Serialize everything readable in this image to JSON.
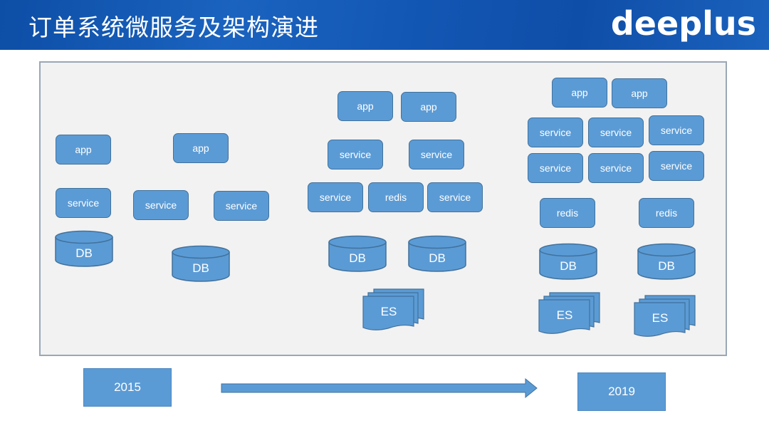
{
  "header": {
    "title": "订单系统微服务及架构演进",
    "logo": "deeplus",
    "background_color": "#1559b5"
  },
  "colors": {
    "node_fill": "#5b9bd5",
    "node_border": "#41719c",
    "panel_fill": "#f2f2f2",
    "panel_border": "#9aa7b6"
  },
  "stages": [
    {
      "name": "stage-2015",
      "apps": [
        "app",
        "app"
      ],
      "services": [
        "service",
        "service",
        "service"
      ],
      "dbs": [
        "DB",
        "DB"
      ]
    },
    {
      "name": "stage-middle",
      "apps": [
        "app",
        "app"
      ],
      "services_row1": [
        "service",
        "service"
      ],
      "services_row2": [
        "service",
        "redis",
        "service"
      ],
      "dbs": [
        "DB",
        "DB"
      ],
      "es": [
        "ES"
      ]
    },
    {
      "name": "stage-2019",
      "apps": [
        "app",
        "app"
      ],
      "services_row1": [
        "service",
        "service",
        "service"
      ],
      "services_row2": [
        "service",
        "service",
        "service"
      ],
      "redis": [
        "redis",
        "redis"
      ],
      "dbs": [
        "DB",
        "DB"
      ],
      "es": [
        "ES",
        "ES"
      ]
    }
  ],
  "timeline": {
    "start": "2015",
    "end": "2019"
  }
}
